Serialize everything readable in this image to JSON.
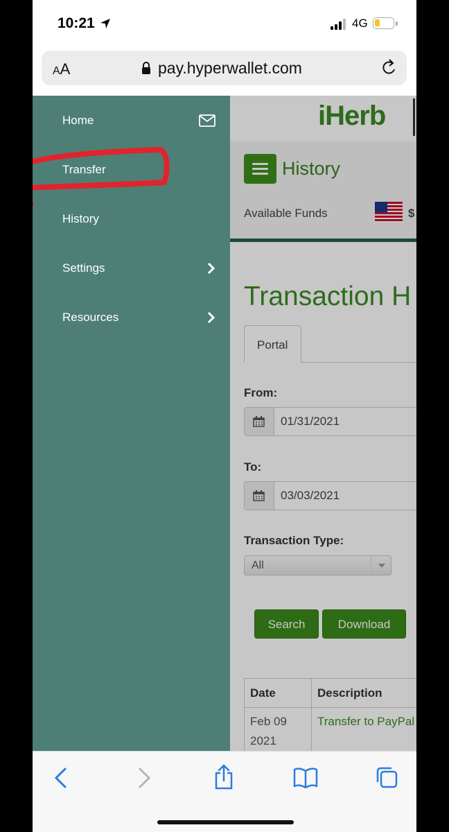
{
  "status": {
    "time": "10:21",
    "network": "4G",
    "battery_color": "#f2c230"
  },
  "browser": {
    "text_size_small": "A",
    "text_size_large": "A",
    "url": "pay.hyperwallet.com"
  },
  "drawer": {
    "background": "#4e7f76",
    "items": [
      {
        "label": "Home",
        "icon": "mail-icon"
      },
      {
        "label": "Transfer"
      },
      {
        "label": "History"
      },
      {
        "label": "Settings",
        "icon": "chevron-right-icon"
      },
      {
        "label": "Resources",
        "icon": "chevron-right-icon"
      }
    ],
    "annotation_color": "#e0242e"
  },
  "header": {
    "logo": "iHerb",
    "section_title": "History",
    "funds_label": "Available Funds",
    "funds_value": "$"
  },
  "main": {
    "title": "Transaction H",
    "tab_label": "Portal",
    "from_label": "From:",
    "from_value": "01/31/2021",
    "to_label": "To:",
    "to_value": "03/03/2021",
    "type_label": "Transaction Type:",
    "type_value": "All",
    "search_label": "Search",
    "download_label": "Download",
    "table": {
      "headers": [
        "Date",
        "Description"
      ],
      "rows": [
        {
          "date_line1": "Feb 09",
          "date_line2": "2021",
          "description": "Transfer to PayPal"
        }
      ]
    }
  },
  "accent": "#3b8a1b"
}
